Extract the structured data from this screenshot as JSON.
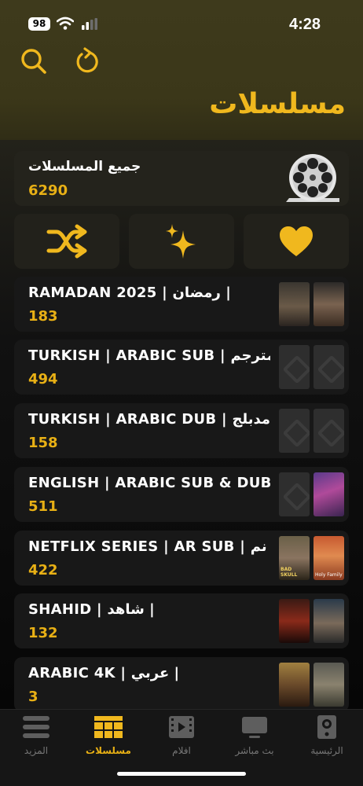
{
  "status": {
    "battery": "98",
    "time": "4:28"
  },
  "header": {
    "title": "مسلسلات",
    "search_icon": "search-icon",
    "refresh_icon": "refresh-icon"
  },
  "all_series": {
    "title": "جميع المسلسلات",
    "count": "6290",
    "icon": "film-reel-icon"
  },
  "actions": [
    {
      "name": "shuffle",
      "icon": "shuffle-icon"
    },
    {
      "name": "new",
      "icon": "sparkles-icon"
    },
    {
      "name": "favorites",
      "icon": "heart-icon"
    }
  ],
  "categories": [
    {
      "title": "RAMADAN 2025 | رمضان |",
      "count": "183"
    },
    {
      "title": "TURKISH | ARABIC SUB | مترجم",
      "count": "494"
    },
    {
      "title": "TURKISH | ARABIC DUB | مدبلج",
      "count": "158"
    },
    {
      "title": "ENGLISH | ARABIC SUB & DUB",
      "count": "511"
    },
    {
      "title": "NETFLIX SERIES | AR SUB | نم",
      "count": "422"
    },
    {
      "title": "SHAHID | شاهد |",
      "count": "132"
    },
    {
      "title": "ARABIC 4K | عربي |",
      "count": "3"
    }
  ],
  "poster_text": {
    "bad_skull": "BAD SKULL",
    "holy_family": "Holy Family"
  },
  "tabs": [
    {
      "label": "المزيد",
      "icon": "menu-icon"
    },
    {
      "label": "مسلسلات",
      "icon": "series-grid-icon",
      "active": true
    },
    {
      "label": "افلام",
      "icon": "film-icon"
    },
    {
      "label": "بث مباشر",
      "icon": "tv-icon"
    },
    {
      "label": "الرئيسية",
      "icon": "home-icon"
    }
  ],
  "colors": {
    "accent": "#f0b81e",
    "count": "#e8b015",
    "header_bg": "#3b3719",
    "card_bg": "#181818"
  }
}
